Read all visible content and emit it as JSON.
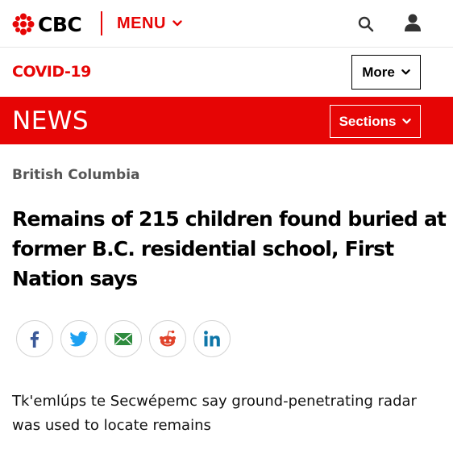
{
  "header": {
    "logo_text": "CBC",
    "menu_label": "MENU"
  },
  "subnav": {
    "covid_link": "COVID-19",
    "more_label": "More"
  },
  "news_bar": {
    "title": "NEWS",
    "sections_label": "Sections"
  },
  "article": {
    "category": "British Columbia",
    "headline": "Remains of 215 children found buried at former B.C. residential school, First Nation says",
    "deck": "Tk'emlúps te Secwépemc say ground-penetrating radar was used to locate remains"
  },
  "share": [
    {
      "icon": "facebook-icon",
      "color": "#3b5998"
    },
    {
      "icon": "twitter-icon",
      "color": "#1da1f2"
    },
    {
      "icon": "email-icon",
      "color": "#2e8b3e"
    },
    {
      "icon": "reddit-icon",
      "color": "#e0432b"
    },
    {
      "icon": "linkedin-icon",
      "color": "#0e76a8"
    }
  ],
  "colors": {
    "brand_red": "#e60505"
  }
}
